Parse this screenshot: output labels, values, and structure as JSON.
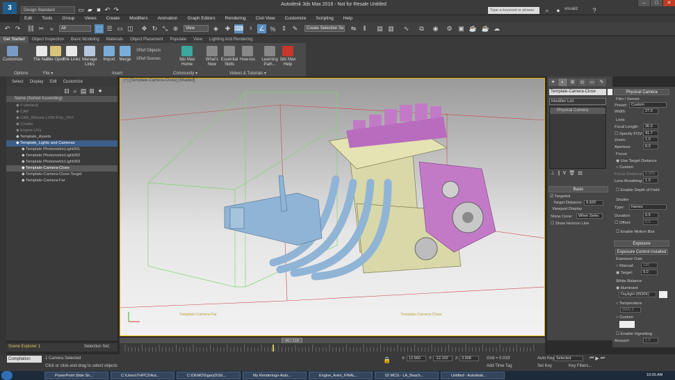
{
  "titlebar": {
    "workspace": "Design Standard",
    "title": "Autodesk 3ds Max 2016 - Not for Resale   Untitled",
    "search_placeholder": "Type a keyword or phrase",
    "user": "visualiz"
  },
  "menu": [
    "Edit",
    "Tools",
    "Group",
    "Views",
    "Create",
    "Modifiers",
    "Animation",
    "Graph Editors",
    "Rendering",
    "Civil View",
    "Customize",
    "Scripting",
    "Help"
  ],
  "toolbar": {
    "filter": "All",
    "refcoord": "View",
    "selset": "Create Selection Se"
  },
  "ribbon_tabs": [
    "Get Started",
    "Object Inspection",
    "Basic Modeling",
    "Materials",
    "Object Placement",
    "Populate",
    "View",
    "Lighting And Rendering"
  ],
  "ribbon_buttons": [
    {
      "label": "Customize"
    },
    {
      "label": "File New"
    },
    {
      "label": "File Open"
    },
    {
      "label": "File Links"
    },
    {
      "label": "Manage Links"
    },
    {
      "label": "Import"
    },
    {
      "label": "Merge"
    },
    {
      "label": "3ds Max Home"
    },
    {
      "label": "What's New"
    },
    {
      "label": "Essential Skills"
    },
    {
      "label": "How-tos"
    },
    {
      "label": "Learning Path..."
    },
    {
      "label": "3ds Max Help"
    }
  ],
  "ribbon_small": [
    "XRef Objects",
    "XRef Scenes"
  ],
  "ribbon_groups": [
    "Options",
    "File ▾",
    "Insert",
    "Community ▾",
    "Videos & Tutorials ▾"
  ],
  "scene_explorer": {
    "menu": [
      "Select",
      "Display",
      "Edit",
      "Customize"
    ],
    "header": "Name (Sorted Ascending)",
    "rows": [
      {
        "text": "0 (default)",
        "style": "dim",
        "indent": 14
      },
      {
        "text": "CAR",
        "style": "dim",
        "indent": 14
      },
      {
        "text": "CAR_Wheels LOW Poly_OFF",
        "style": "dim",
        "indent": 14
      },
      {
        "text": "Credits",
        "style": "dim",
        "indent": 14
      },
      {
        "text": "Engine UVs",
        "style": "dim",
        "indent": 14
      },
      {
        "text": "Template_Assets",
        "style": "",
        "indent": 14
      },
      {
        "text": "Template_Lights and Cameras",
        "style": "hl",
        "indent": 14
      },
      {
        "text": "Template PhotometricLight001",
        "style": "",
        "indent": 22
      },
      {
        "text": "Template PhotometricLight002",
        "style": "",
        "indent": 22
      },
      {
        "text": "Template PhotometricLight003",
        "style": "",
        "indent": 22
      },
      {
        "text": "Template-Camera-Close",
        "style": "sel",
        "indent": 22
      },
      {
        "text": "Template-Camera-Close.Target",
        "style": "",
        "indent": 22
      },
      {
        "text": "Template-Camera-Far",
        "style": "",
        "indent": 22
      }
    ],
    "footer": "Scene Explorer 1",
    "selset": "Selection Set:"
  },
  "viewport": {
    "label": "[+] [Template-Camera-Close] [Shaded]",
    "cam_label": "Template-Camera-Far",
    "target_label": "Template-Camera-Close"
  },
  "command_panel": {
    "object_name": "Template-Camera-Close",
    "modifier_list": "Modifier List",
    "stack_item": "Physical Camera",
    "basic": {
      "title": "Basic",
      "targeted": "Targeted",
      "target_distance_label": "Target Distance:",
      "target_distance": "9.926'",
      "viewport_display": "Viewport Display",
      "show_cone_label": "Show Cone:",
      "show_cone": "When Selec",
      "show_horizon": "Show Horizon Line"
    }
  },
  "physical_camera": {
    "title": "Physical Camera",
    "film_sensor": "Film / Sensor",
    "preset_label": "Preset:",
    "preset": "Custom",
    "width_label": "Width:",
    "width": "27.0",
    "lens": "Lens",
    "focal_label": "Focal Length:",
    "focal": "36.0",
    "specify_fov": "Specify FOV:",
    "fov": "41.7",
    "zoom_label": "Zoom:",
    "zoom": "1.0",
    "aperture_label": "Aperture:",
    "aperture": "8.0",
    "focus": "Focus",
    "use_target": "Use Target Distance",
    "custom": "Custom",
    "focus_distance_label": "Focus Distance:",
    "focus_distance": "9.926'",
    "lens_breathing_label": "Lens Breathing:",
    "lens_breathing": "1.0",
    "enable_dof": "Enable Depth of Field",
    "shutter": "Shutter",
    "type_label": "Type:",
    "type": "frames",
    "duration_label": "Duration:",
    "duration": "0.5",
    "offset_label": "Offset:",
    "offset": "0.0",
    "motion_blur": "Enable Motion Blur",
    "exposure_title": "Exposure",
    "exposure_ctrl": "Exposure Control Installed",
    "exposure_gain": "Exposure Gain",
    "manual_label": "Manual:",
    "manual": "100",
    "target_label": "Target:",
    "target_ev": "9.0",
    "white_balance": "White Balance",
    "illuminant": "Illuminant",
    "daylight": "Daylight (6500K)",
    "temperature": "Temperature",
    "kelvin": "6500.0",
    "custom_wb": "Custom",
    "vignetting": "Enable Vignetting",
    "amount_label": "Amount:",
    "amount": "1.0"
  },
  "timeline": {
    "frame": "46 / 119"
  },
  "status": {
    "selected": "1 Camera Selected",
    "hint": "Click or click-and-drag to select objects",
    "x": "12.960",
    "y": "-12.102",
    "z": "3.008",
    "grid": "Grid = 0.033'",
    "add_time_tag": "Add Time Tag",
    "auto_key": "Auto Key",
    "set_key": "Set Key",
    "selected_dd": "Selected",
    "key_filters": "Key Filters...",
    "compile": "Compilation"
  },
  "taskbar": [
    {
      "label": "PowerPoint Slide Sh..."
    },
    {
      "label": "C:\\Users\\THPC2\\Aut..."
    },
    {
      "label": "C:\\DEMOS\\garyD\\3d..."
    },
    {
      "label": "My Renderings-Auto..."
    },
    {
      "label": "Engine_Anim_FINAL..."
    },
    {
      "label": "02 MCG - LA_Beach..."
    },
    {
      "label": "Untitled - Autodesk..."
    }
  ],
  "clock": "10:05 AM",
  "colors": {
    "accent": "#5c8fbf",
    "engine_pipe": "#8fb4d6",
    "engine_magenta": "#c27ac7",
    "engine_cream": "#d9d8a8",
    "selection": "#e1b200"
  }
}
